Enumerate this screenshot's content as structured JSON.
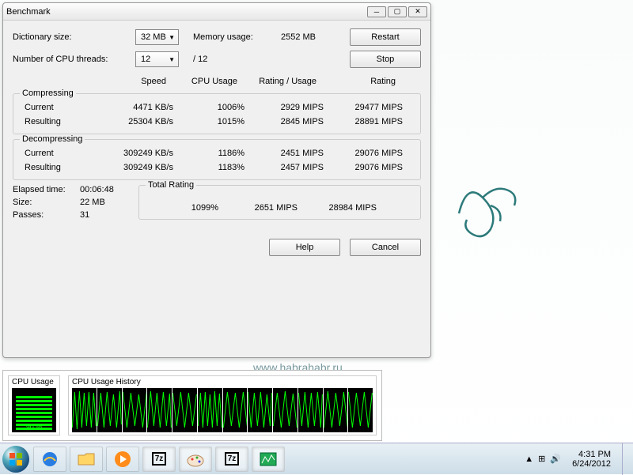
{
  "window": {
    "title": "Benchmark",
    "top": {
      "dict_size_label": "Dictionary size:",
      "dict_size_value": "32 MB",
      "mem_usage_label": "Memory usage:",
      "mem_usage_value": "2552 MB",
      "threads_label": "Number of CPU threads:",
      "threads_value": "12",
      "threads_max": "/ 12",
      "restart": "Restart",
      "stop": "Stop"
    },
    "headers": {
      "speed": "Speed",
      "cpu": "CPU Usage",
      "ru": "Rating / Usage",
      "rating": "Rating"
    },
    "compressing": {
      "title": "Compressing",
      "rows": {
        "current": {
          "label": "Current",
          "speed": "4471 KB/s",
          "cpu": "1006%",
          "ru": "2929 MIPS",
          "rating": "29477 MIPS"
        },
        "resulting": {
          "label": "Resulting",
          "speed": "25304 KB/s",
          "cpu": "1015%",
          "ru": "2845 MIPS",
          "rating": "28891 MIPS"
        }
      }
    },
    "decompressing": {
      "title": "Decompressing",
      "rows": {
        "current": {
          "label": "Current",
          "speed": "309249 KB/s",
          "cpu": "1186%",
          "ru": "2451 MIPS",
          "rating": "29076 MIPS"
        },
        "resulting": {
          "label": "Resulting",
          "speed": "309249 KB/s",
          "cpu": "1183%",
          "ru": "2457 MIPS",
          "rating": "29076 MIPS"
        }
      }
    },
    "bottom": {
      "elapsed_label": "Elapsed time:",
      "elapsed": "00:06:48",
      "size_label": "Size:",
      "size": "22 MB",
      "passes_label": "Passes:",
      "passes": "31",
      "total_title": "Total Rating",
      "total": {
        "cpu": "1099%",
        "ru": "2651 MIPS",
        "rating": "28984 MIPS"
      }
    },
    "buttons": {
      "help": "Help",
      "cancel": "Cancel"
    }
  },
  "taskmgr": {
    "cpu_title": "CPU Usage",
    "hist_title": "CPU Usage History",
    "pct": "90 %"
  },
  "watermark": "www.habrahabr.ru",
  "tray": {
    "time": "4:31 PM",
    "date": "6/24/2012"
  },
  "icons": {
    "min": "─",
    "max": "▢",
    "close": "✕",
    "chev": "▼",
    "flag": "⊞",
    "net": "▲",
    "vol": "🔊"
  }
}
